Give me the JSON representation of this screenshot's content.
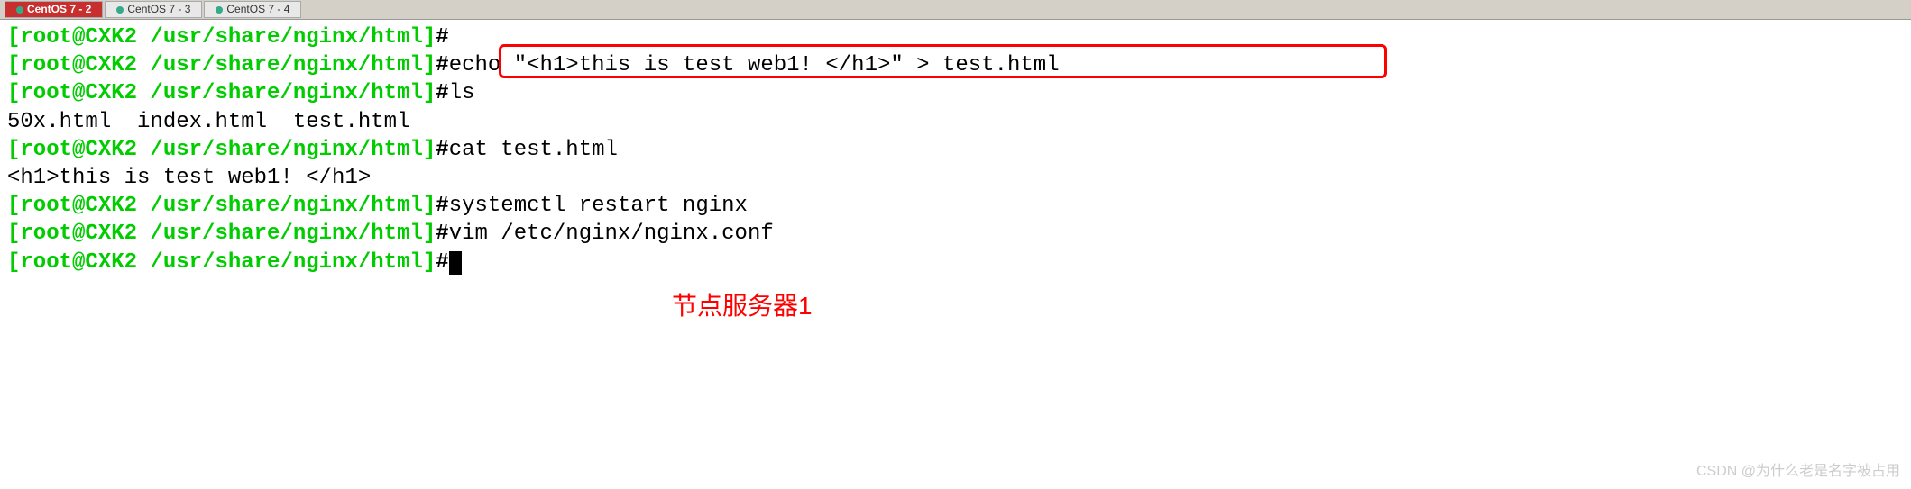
{
  "tabs": [
    {
      "label": "CentOS 7 - 2",
      "active": true
    },
    {
      "label": "CentOS 7 - 3",
      "active": false
    },
    {
      "label": "CentOS 7 - 4",
      "active": false
    }
  ],
  "prompt": "[root@CXK2 /usr/share/nginx/html]",
  "hash": "#",
  "lines": {
    "l1_cmd": "",
    "l2_cmd": "echo \"<h1>this is test web1! </h1>\" > test.html",
    "l3_cmd": "ls",
    "l4_out": "50x.html  index.html  test.html",
    "l5_cmd": "cat test.html",
    "l6_out": "<h1>this is test web1! </h1>",
    "l7_cmd": "systemctl restart nginx",
    "l8_cmd": "vim /etc/nginx/nginx.conf",
    "l9_cmd": ""
  },
  "annotation": "节点服务器1",
  "watermark": "CSDN @为什么老是名字被占用"
}
